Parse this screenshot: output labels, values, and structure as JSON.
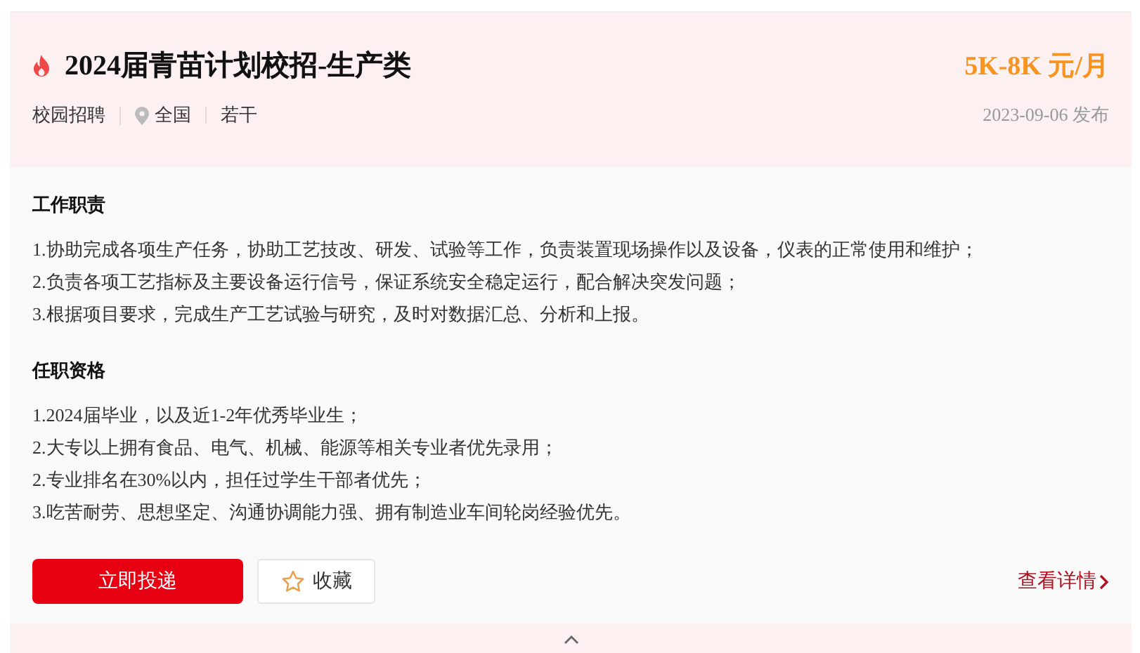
{
  "job": {
    "title": "2024届青苗计划校招-生产类",
    "hot": true,
    "salary": "5K-8K 元/月",
    "tags": [
      {
        "text": "校园招聘",
        "kind": "plain"
      },
      {
        "text": "全国",
        "kind": "location"
      },
      {
        "text": "若干",
        "kind": "plain"
      }
    ],
    "posted": "2023-09-06 发布"
  },
  "sections": [
    {
      "heading": "工作职责",
      "lines": [
        "1.协助完成各项生产任务，协助工艺技改、研发、试验等工作，负责装置现场操作以及设备，仪表的正常使用和维护；",
        "2.负责各项工艺指标及主要设备运行信号，保证系统安全稳定运行，配合解决突发问题；",
        "3.根据项目要求，完成生产工艺试验与研究，及时对数据汇总、分析和上报。"
      ]
    },
    {
      "heading": "任职资格",
      "lines": [
        "1.2024届毕业，以及近1-2年优秀毕业生；",
        "2.大专以上拥有食品、电气、机械、能源等相关专业者优先录用；",
        "2.专业排名在30%以内，担任过学生干部者优先；",
        "3.吃苦耐劳、思想坚定、沟通协调能力强、拥有制造业车间轮岗经验优先。"
      ]
    }
  ],
  "actions": {
    "apply": "立即投递",
    "favorite": "收藏",
    "details": "查看详情"
  }
}
